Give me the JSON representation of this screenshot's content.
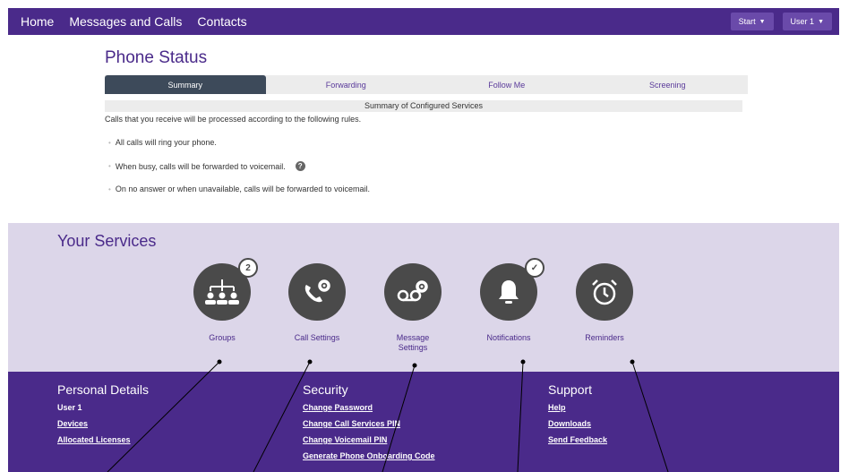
{
  "nav": {
    "links": [
      "Home",
      "Messages and Calls",
      "Contacts"
    ],
    "start_label": "Start",
    "user_label": "User 1"
  },
  "phone_status": {
    "title": "Phone Status",
    "tabs": [
      "Summary",
      "Forwarding",
      "Follow Me",
      "Screening"
    ],
    "active_tab": "Summary",
    "summary_header": "Summary of Configured Services",
    "intro": "Calls that you receive will be processed according to the following rules.",
    "rules": [
      "All calls will ring your phone.",
      "When busy, calls will be forwarded to voicemail.",
      "On no answer or when unavailable, calls will be forwarded to voicemail."
    ]
  },
  "services": {
    "title": "Your Services",
    "items": [
      {
        "label": "Groups",
        "icon": "groups-icon",
        "badge": "2"
      },
      {
        "label": "Call Settings",
        "icon": "call-settings-icon",
        "badge": ""
      },
      {
        "label": "Message Settings",
        "icon": "voicemail-settings-icon",
        "badge": ""
      },
      {
        "label": "Notifications",
        "icon": "bell-icon",
        "badge": "✓"
      },
      {
        "label": "Reminders",
        "icon": "alarm-clock-icon",
        "badge": ""
      }
    ]
  },
  "footer": {
    "personal": {
      "heading": "Personal Details",
      "user": "User 1",
      "links": [
        "Devices",
        "Allocated Licenses"
      ]
    },
    "security": {
      "heading": "Security",
      "links": [
        "Change Password",
        "Change Call Services PIN",
        "Change Voicemail PIN",
        "Generate Phone Onboarding Code"
      ]
    },
    "support": {
      "heading": "Support",
      "links": [
        "Help",
        "Downloads",
        "Send Feedback"
      ]
    }
  },
  "colors": {
    "brand": "#4a2a8a",
    "services_bg": "#dcd6e9",
    "icon_circle": "#4a4a4a"
  }
}
